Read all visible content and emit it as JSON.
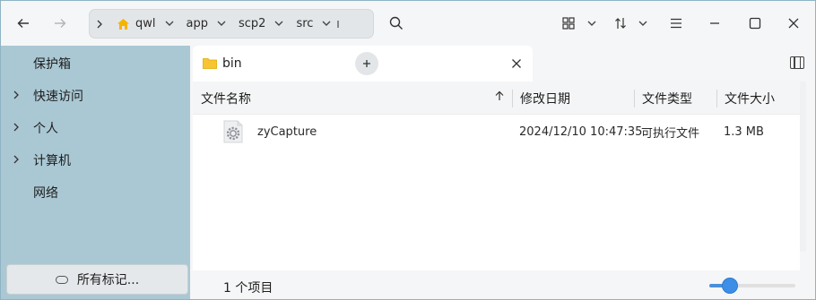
{
  "toolbar": {
    "back_icon": "arrow-left",
    "forward_icon": "arrow-right",
    "search_icon": "search",
    "view_icon": "grid-view",
    "sort_icon": "sort",
    "menu_icon": "hamburger-menu"
  },
  "breadcrumb": {
    "items": [
      {
        "label": "qwl",
        "icon": "home"
      },
      {
        "label": "app"
      },
      {
        "label": "scp2"
      },
      {
        "label": "src"
      }
    ]
  },
  "window_controls": [
    "minimize",
    "maximize",
    "close"
  ],
  "sidebar": {
    "items": [
      {
        "label": "保护箱",
        "expandable": false
      },
      {
        "label": "快速访问",
        "expandable": true
      },
      {
        "label": "个人",
        "expandable": true
      },
      {
        "label": "计算机",
        "expandable": true
      },
      {
        "label": "网络",
        "expandable": false
      }
    ],
    "tags_button": "所有标记..."
  },
  "tabs": [
    {
      "label": "bin",
      "icon": "folder"
    }
  ],
  "columns": [
    {
      "label": "文件名称"
    },
    {
      "label": "修改日期"
    },
    {
      "label": "文件类型"
    },
    {
      "label": "文件大小"
    }
  ],
  "files": [
    {
      "name": "zyCapture",
      "modified": "2024/12/10 10:47:35",
      "type": "可执行文件",
      "size": "1.3 MB",
      "icon": "executable-gear"
    }
  ],
  "status": {
    "item_count": "1 个项目",
    "zoom_fraction": 0.22
  },
  "colors": {
    "sidebar_bg": "#aac8d4",
    "accent": "#3d8ee6"
  }
}
